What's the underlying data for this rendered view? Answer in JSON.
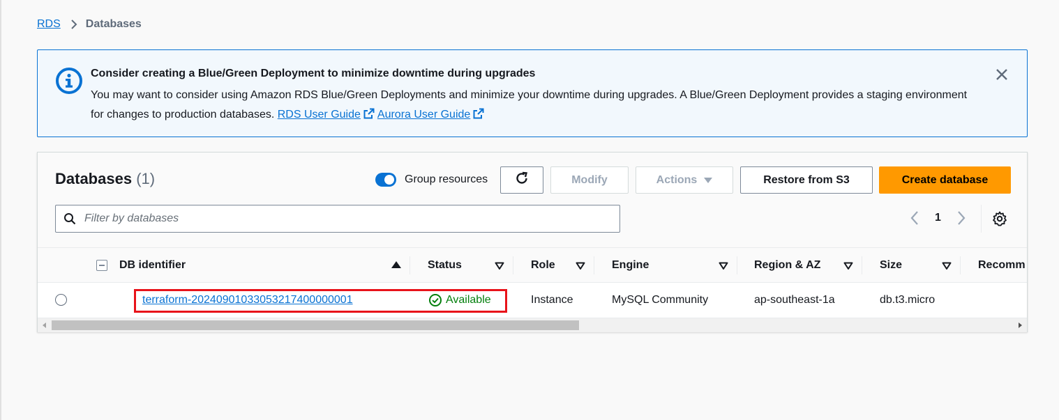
{
  "breadcrumb": {
    "root": "RDS",
    "current": "Databases"
  },
  "alert": {
    "title": "Consider creating a Blue/Green Deployment to minimize downtime during upgrades",
    "body": "You may want to consider using Amazon RDS Blue/Green Deployments and minimize your downtime during upgrades. A Blue/Green Deployment provides a staging environment for changes to production databases.",
    "link1": "RDS User Guide",
    "link2": "Aurora User Guide",
    "icons": {
      "info": "info-circle-icon",
      "close": "close-icon",
      "external": "external-link-icon"
    }
  },
  "panel": {
    "title": "Databases",
    "count": "(1)",
    "group_toggle_label": "Group resources",
    "group_toggle_on": true,
    "buttons": {
      "modify": "Modify",
      "actions": "Actions",
      "restore": "Restore from S3",
      "create": "Create database"
    },
    "filter_placeholder": "Filter by databases",
    "page": "1"
  },
  "table": {
    "columns": [
      "DB identifier",
      "Status",
      "Role",
      "Engine",
      "Region & AZ",
      "Size",
      "Recomm"
    ],
    "rows": [
      {
        "identifier": "terraform-20240901033053217400000001",
        "status": "Available",
        "role": "Instance",
        "engine": "MySQL Community",
        "region": "ap-southeast-1a",
        "size": "db.t3.micro"
      }
    ]
  },
  "colors": {
    "link": "#0972d3",
    "primary": "#ff9900",
    "success": "#037f0c",
    "highlight": "#e8131a"
  }
}
